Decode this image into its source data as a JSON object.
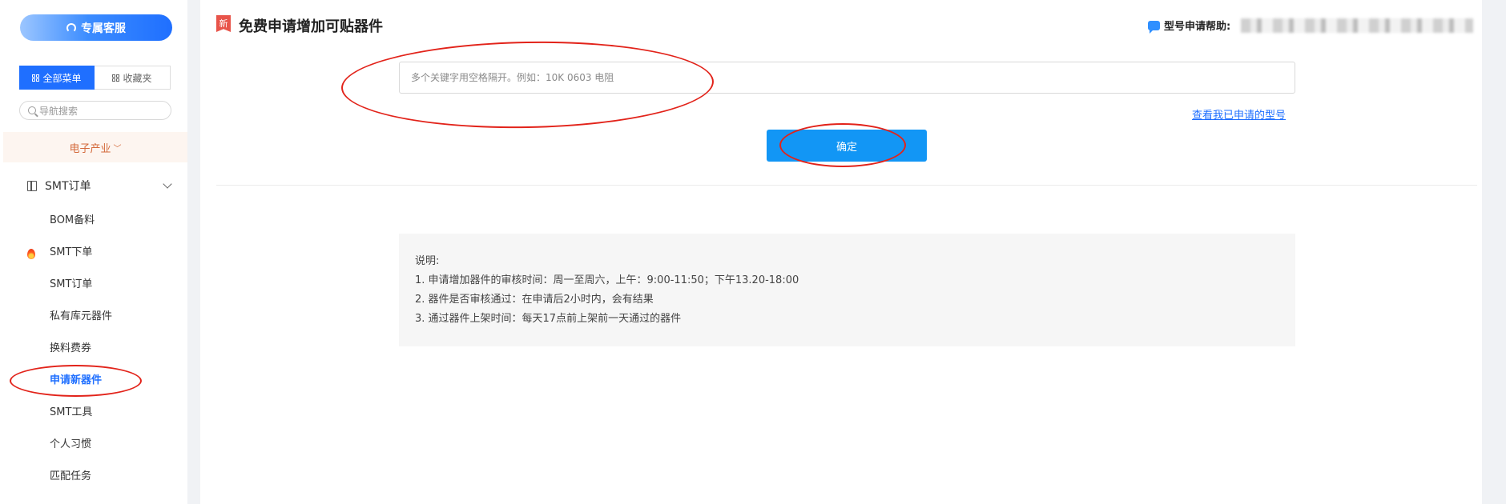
{
  "sidebar": {
    "service_button": "专属客服",
    "tabs": {
      "all_menu": "全部菜单",
      "favorites": "收藏夹"
    },
    "nav_search_placeholder": "导航搜索",
    "industry": "电子产业",
    "group": {
      "label": "SMT订单",
      "icon": "book-icon"
    },
    "items": [
      {
        "label": "BOM备料"
      },
      {
        "label": "SMT下单",
        "icon": "flame-icon"
      },
      {
        "label": "SMT订单"
      },
      {
        "label": "私有库元器件"
      },
      {
        "label": "换料费券"
      },
      {
        "label": "申请新器件",
        "active": true
      },
      {
        "label": "SMT工具"
      },
      {
        "label": "个人习惯"
      },
      {
        "label": "匹配任务"
      }
    ]
  },
  "main": {
    "title_badge": "新",
    "title": "免费申请增加可贴器件",
    "help_label": "型号申请帮助:",
    "search_placeholder": "多个关键字用空格隔开。例如：10K 0603 电阻",
    "view_link": "查看我已申请的型号",
    "confirm_button": "确定",
    "notes": {
      "heading": "说明:",
      "lines": [
        "1. 申请增加器件的审核时间：周一至周六，上午：9:00-11:50；下午13.20-18:00",
        "2. 器件是否审核通过：在申请后2小时内，会有结果",
        "3. 通过器件上架时间：每天17点前上架前一天通过的器件"
      ]
    }
  },
  "colors": {
    "accent": "#1f6fff",
    "button": "#1296f5",
    "annotation": "#e2231a",
    "industry": "#d46a3c"
  }
}
